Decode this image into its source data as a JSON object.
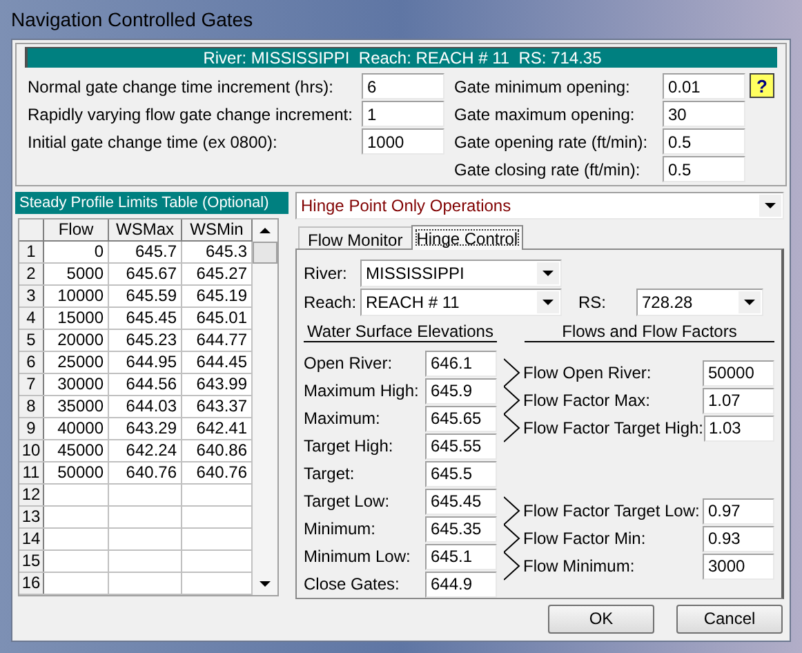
{
  "window": {
    "title": "Navigation Controlled Gates"
  },
  "location_bar": "River: MISSISSIPPI  Reach: REACH # 11  RS: 714.35",
  "settings_left": [
    {
      "label": "Normal gate change time increment (hrs):",
      "value": "6"
    },
    {
      "label": "Rapidly varying flow gate change increment:",
      "value": "1"
    },
    {
      "label": "Initial gate change time (ex 0800):",
      "value": "1000"
    }
  ],
  "settings_right": [
    {
      "label": "Gate minimum opening:",
      "value": "0.01"
    },
    {
      "label": "Gate maximum opening:",
      "value": "30"
    },
    {
      "label": "Gate opening rate (ft/min):",
      "value": "0.5"
    },
    {
      "label": "Gate closing rate (ft/min):",
      "value": "0.5"
    }
  ],
  "help_button": "?",
  "steady_table": {
    "title": "Steady Profile Limits Table (Optional)",
    "columns": [
      "Flow",
      "WSMax",
      "WSMin"
    ],
    "rows": [
      {
        "number": "1",
        "cells": [
          "0",
          "645.7",
          "645.3"
        ]
      },
      {
        "number": "2",
        "cells": [
          "5000",
          "645.67",
          "645.27"
        ]
      },
      {
        "number": "3",
        "cells": [
          "10000",
          "645.59",
          "645.19"
        ]
      },
      {
        "number": "4",
        "cells": [
          "15000",
          "645.45",
          "645.01"
        ]
      },
      {
        "number": "5",
        "cells": [
          "20000",
          "645.23",
          "644.77"
        ]
      },
      {
        "number": "6",
        "cells": [
          "25000",
          "644.95",
          "644.45"
        ]
      },
      {
        "number": "7",
        "cells": [
          "30000",
          "644.56",
          "643.99"
        ]
      },
      {
        "number": "8",
        "cells": [
          "35000",
          "644.03",
          "643.37"
        ]
      },
      {
        "number": "9",
        "cells": [
          "40000",
          "643.29",
          "642.41"
        ]
      },
      {
        "number": "10",
        "cells": [
          "45000",
          "642.24",
          "640.86"
        ]
      },
      {
        "number": "11",
        "cells": [
          "50000",
          "640.76",
          "640.76"
        ]
      },
      {
        "number": "12"
      },
      {
        "number": "13"
      },
      {
        "number": "14"
      },
      {
        "number": "15"
      },
      {
        "number": "16"
      }
    ]
  },
  "operation_mode": "Hinge Point Only Operations",
  "tabs": [
    {
      "label": "Flow Monitor",
      "selected": false
    },
    {
      "label": "Hinge Control",
      "selected": true
    }
  ],
  "hinge_control": {
    "river": {
      "label": "River:",
      "value": "MISSISSIPPI"
    },
    "reach": {
      "label": "Reach:",
      "value": "REACH # 11"
    },
    "rs": {
      "label": "RS:",
      "value": "728.28"
    },
    "wse": {
      "title": "Water Surface Elevations",
      "items": [
        {
          "label": "Open River:",
          "value": "646.1"
        },
        {
          "label": "Maximum High:",
          "value": "645.9"
        },
        {
          "label": "Maximum:",
          "value": "645.65"
        },
        {
          "label": "Target High:",
          "value": "645.55"
        },
        {
          "label": "Target:",
          "value": "645.5"
        },
        {
          "label": "Target Low:",
          "value": "645.45"
        },
        {
          "label": "Minimum:",
          "value": "645.35"
        },
        {
          "label": "Minimum Low:",
          "value": "645.1"
        },
        {
          "label": "Close Gates:",
          "value": "644.9"
        }
      ]
    },
    "flows": {
      "title": "Flows and Flow Factors",
      "upper": [
        {
          "label": "Flow Open River:",
          "value": "50000"
        },
        {
          "label": "Flow Factor Max:",
          "value": "1.07"
        },
        {
          "label": "Flow Factor Target High:",
          "value": "1.03"
        }
      ],
      "lower": [
        {
          "label": "Flow Factor Target Low:",
          "value": "0.97"
        },
        {
          "label": "Flow Factor Min:",
          "value": "0.93"
        },
        {
          "label": "Flow Minimum:",
          "value": "3000"
        }
      ]
    }
  },
  "buttons": [
    "OK",
    "Cancel"
  ]
}
